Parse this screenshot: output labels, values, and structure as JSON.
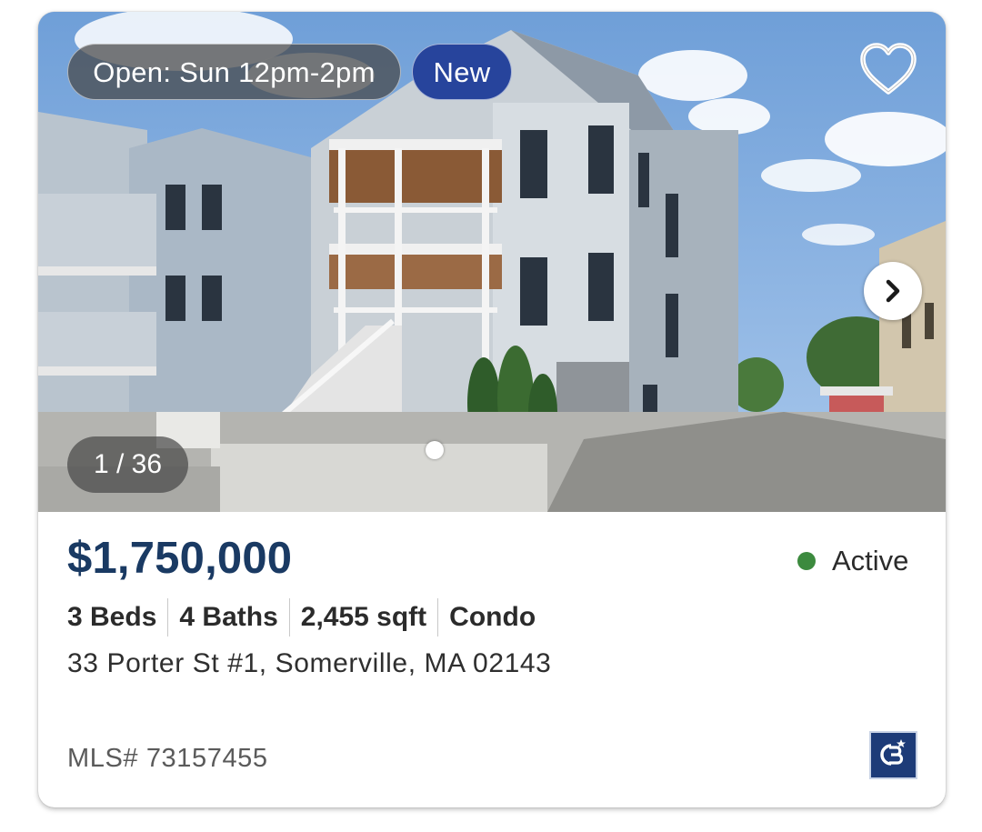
{
  "listing": {
    "open_house_label": "Open: Sun 12pm-2pm",
    "new_badge": "New",
    "photo_counter": "1 / 36",
    "price": "$1,750,000",
    "status": "Active",
    "specs": {
      "beds": "3 Beds",
      "baths": "4 Baths",
      "sqft": "2,455 sqft",
      "type": "Condo"
    },
    "address": "33 Porter St #1, Somerville, MA 02143",
    "mls": "MLS# 73157455"
  },
  "icons": {
    "favorite": "heart-outline-icon",
    "next_photo": "chevron-right-icon",
    "brand_logo": "coldwell-banker-logo"
  },
  "colors": {
    "price": "#1a3a63",
    "new_badge": "#27449c",
    "status_active": "#3c8a3e",
    "logo_bg": "#1d3b78"
  }
}
